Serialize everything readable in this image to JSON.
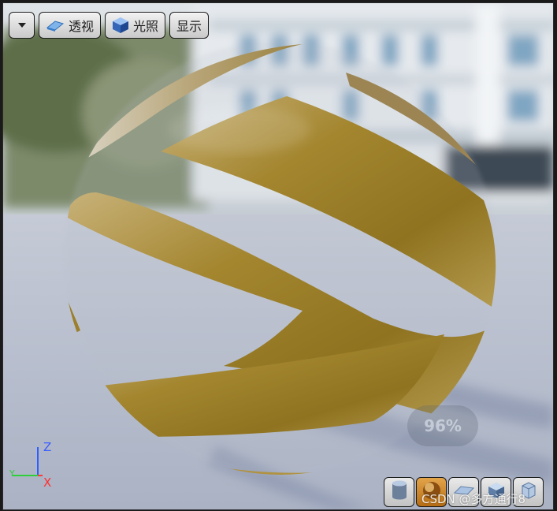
{
  "toolbar": {
    "dropdown_icon": "chevron-down-icon",
    "perspective": {
      "label": "透视",
      "icon": "perspective-icon"
    },
    "lighting": {
      "label": "光照",
      "icon": "lit-cube-icon"
    },
    "show": {
      "label": "显示"
    }
  },
  "overlay": {
    "zoom": "96%"
  },
  "axes": {
    "z": "Z",
    "y": "Y",
    "x": "X"
  },
  "bottom_bar": {
    "buttons": [
      {
        "icon": "cylinder-preview-icon",
        "active": false
      },
      {
        "icon": "sphere-preview-icon",
        "active": true
      },
      {
        "icon": "plane-preview-icon",
        "active": false
      },
      {
        "icon": "cube-preview-icon",
        "active": false
      },
      {
        "icon": "mesh-preview-icon",
        "active": false
      }
    ]
  },
  "watermark": "CSDN @多方通行8",
  "colors": {
    "material_gold": "#a8862e",
    "floor": "#b9bfcd",
    "toolbar_button": "#d8d8d8",
    "active_button": "#d08a2a"
  }
}
